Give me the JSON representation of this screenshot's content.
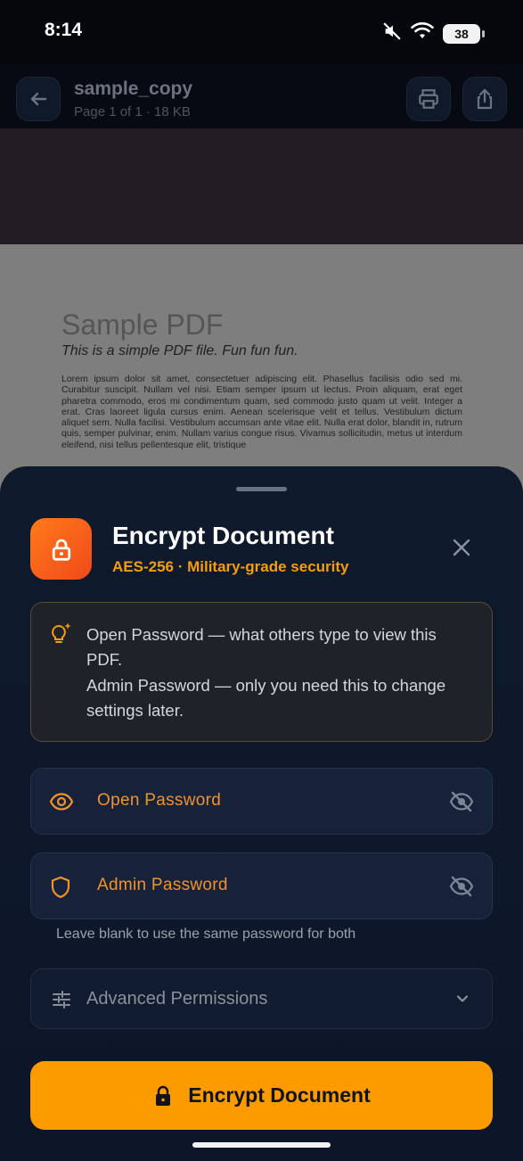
{
  "status_bar": {
    "time": "8:14",
    "battery": "38",
    "icons": [
      "mute-icon",
      "wifi-icon",
      "battery-icon"
    ]
  },
  "app_bar": {
    "title": "sample_copy",
    "subtitle": "Page 1 of 1 · 18 KB",
    "icons": [
      "back-arrow-icon",
      "print-icon",
      "share-icon"
    ]
  },
  "pdf_preview": {
    "title": "Sample PDF",
    "subtitle": "This is a simple PDF file. Fun fun fun.",
    "body": "Lorem ipsum dolor sit amet, consectetuer adipiscing elit. Phasellus facilisis odio sed mi. Curabitur suscipit. Nullam vel nisi. Etiam semper ipsum ut lectus. Proin aliquam, erat eget pharetra commodo, eros mi condimentum quam, sed commodo justo quam ut velit. Integer a erat. Cras laoreet ligula cursus enim. Aenean scelerisque velit et tellus. Vestibulum dictum aliquet sem. Nulla facilisi. Vestibulum accumsan ante vitae elit. Nulla erat dolor, blandit in, rutrum quis, semper pulvinar, enim. Nullam varius congue risus. Vivamus sollicitudin, metus ut interdum eleifend, nisi tellus pellentesque elit, tristique"
  },
  "sheet": {
    "title": "Encrypt Document",
    "subtitle": "AES-256 · Military-grade security",
    "hint_lines": [
      "Open Password — what others type to view this",
      "PDF.",
      "Admin Password — only you need this to change",
      "settings later."
    ],
    "open_password_label": "Open Password",
    "admin_password_label": "Admin Password",
    "helper_text": "Leave blank to use the same password for both",
    "advanced_label": "Advanced Permissions",
    "cta_label": "Encrypt Document"
  },
  "colors": {
    "accent": "#f59e0b",
    "cta": "#fb9b00",
    "sheet_bg": "#0f1a2c",
    "field_label": "#f2922d"
  }
}
